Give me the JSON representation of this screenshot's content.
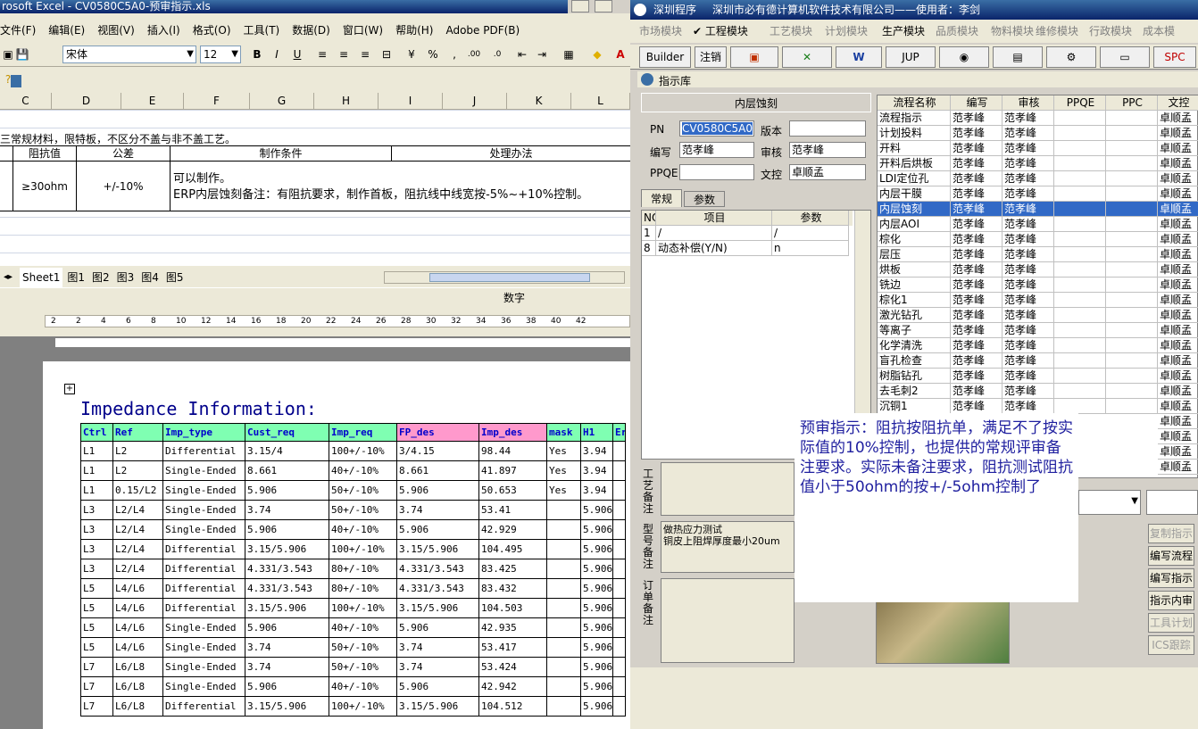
{
  "excel": {
    "title": "rosoft Excel - CV0580C5A0-预审指示.xls",
    "menus": [
      "文件(F)",
      "编辑(E)",
      "视图(V)",
      "插入(I)",
      "格式(O)",
      "工具(T)",
      "数据(D)",
      "窗口(W)",
      "帮助(H)",
      "Adobe PDF(B)"
    ],
    "font_name": "宋体",
    "font_size": "12",
    "columns": [
      "C",
      "D",
      "E",
      "F",
      "G",
      "H",
      "I",
      "J",
      "K",
      "L"
    ],
    "row1_text": "三常规材料，限特板，不区分不盖与非不盖工艺。",
    "headers": [
      "阻抗值",
      "公差",
      "制作条件",
      "处理办法"
    ],
    "row_values": {
      "resistance": "≥30ohm",
      "tolerance": "+/-10%",
      "condition_line1": "可以制作。",
      "condition_line2": "ERP内层蚀刻备注：有阻抗要求，制作首板，阻抗线中线宽按-5%~+10%控制。"
    },
    "sheet_tabs": [
      "Sheet1",
      "图1",
      "图2",
      "图3",
      "图4",
      "图5"
    ],
    "status_text": "数字"
  },
  "word": {
    "ruler_numbers": [
      "2",
      "2",
      "4",
      "6",
      "8",
      "10",
      "12",
      "14",
      "16",
      "18",
      "20",
      "22",
      "24",
      "26",
      "28",
      "30",
      "32",
      "34",
      "36",
      "38",
      "40",
      "42"
    ],
    "title": "Impedance Information:",
    "headers": [
      "Ctrl",
      "Ref",
      "Imp_type",
      "Cust_req",
      "Imp_req",
      "FP_des",
      "Imp_des",
      "mask",
      "H1",
      "Er"
    ],
    "rows": [
      [
        "L1",
        "L2",
        "Differential",
        "3.15/4",
        "100+/-10%",
        "3/4.15",
        "98.44",
        "Yes",
        "3.94",
        ""
      ],
      [
        "L1",
        "L2",
        "Single-Ended",
        "8.661",
        "40+/-10%",
        "8.661",
        "41.897",
        "Yes",
        "3.94",
        ""
      ],
      [
        "L1",
        "0.15/L2",
        "Single-Ended",
        "5.906",
        "50+/-10%",
        "5.906",
        "50.653",
        "Yes",
        "3.94",
        ""
      ],
      [
        "L3",
        "L2/L4",
        "Single-Ended",
        "3.74",
        "50+/-10%",
        "3.74",
        "53.41",
        "",
        "5.906",
        ""
      ],
      [
        "L3",
        "L2/L4",
        "Single-Ended",
        "5.906",
        "40+/-10%",
        "5.906",
        "42.929",
        "",
        "5.906",
        ""
      ],
      [
        "L3",
        "L2/L4",
        "Differential",
        "3.15/5.906",
        "100+/-10%",
        "3.15/5.906",
        "104.495",
        "",
        "5.906",
        ""
      ],
      [
        "L3",
        "L2/L4",
        "Differential",
        "4.331/3.543",
        "80+/-10%",
        "4.331/3.543",
        "83.425",
        "",
        "5.906",
        ""
      ],
      [
        "L5",
        "L4/L6",
        "Differential",
        "4.331/3.543",
        "80+/-10%",
        "4.331/3.543",
        "83.432",
        "",
        "5.906",
        ""
      ],
      [
        "L5",
        "L4/L6",
        "Differential",
        "3.15/5.906",
        "100+/-10%",
        "3.15/5.906",
        "104.503",
        "",
        "5.906",
        ""
      ],
      [
        "L5",
        "L4/L6",
        "Single-Ended",
        "5.906",
        "40+/-10%",
        "5.906",
        "42.935",
        "",
        "5.906",
        ""
      ],
      [
        "L5",
        "L4/L6",
        "Single-Ended",
        "3.74",
        "50+/-10%",
        "3.74",
        "53.417",
        "",
        "5.906",
        ""
      ],
      [
        "L7",
        "L6/L8",
        "Single-Ended",
        "3.74",
        "50+/-10%",
        "3.74",
        "53.424",
        "",
        "5.906",
        ""
      ],
      [
        "L7",
        "L6/L8",
        "Single-Ended",
        "5.906",
        "40+/-10%",
        "5.906",
        "42.942",
        "",
        "5.906",
        ""
      ],
      [
        "L7",
        "L6/L8",
        "Differential",
        "3.15/5.906",
        "100+/-10%",
        "3.15/5.906",
        "104.512",
        "",
        "5.906",
        ""
      ]
    ]
  },
  "erp": {
    "title_app": "深圳程序",
    "title_company": "深圳市必有德计算机软件技术有限公司——使用者：李剑",
    "modules": [
      "市场模块",
      "工程模块",
      "工艺模块",
      "计划模块",
      "生产模块",
      "品质模块",
      "物料模块",
      "维修模块",
      "行政模块",
      "成本模"
    ],
    "tool_builder": "Builder",
    "tool_cancel": "注销",
    "tool_jup": "JUP",
    "tool_spc": "SPC",
    "window_title": "指示库",
    "section": "内层蚀刻",
    "pn_label": "PN",
    "pn_value": "CV0580C5A0",
    "version_label": "版本",
    "version_value": "",
    "author_label": "编写",
    "author_value": "范孝峰",
    "review_label": "审核",
    "review_value": "范孝峰",
    "ppqe_label": "PPQE",
    "ppqe_value": "",
    "doc_label": "文控",
    "doc_value": "卓顺孟",
    "tab_general": "常规",
    "tab_params": "参数",
    "param_headers": [
      "NO",
      "项目",
      "参数"
    ],
    "params": [
      [
        "1",
        "/",
        "/"
      ],
      [
        "8",
        "动态补偿(Y/N)",
        "n"
      ]
    ],
    "process_headers": [
      "流程名称",
      "编写",
      "审核",
      "PPQE",
      "PPC",
      "文控"
    ],
    "processes": [
      [
        "流程指示",
        "范孝峰",
        "范孝峰",
        "",
        "",
        "卓顺孟"
      ],
      [
        "计划投料",
        "范孝峰",
        "范孝峰",
        "",
        "",
        "卓顺孟"
      ],
      [
        "开料",
        "范孝峰",
        "范孝峰",
        "",
        "",
        "卓顺孟"
      ],
      [
        "开料后烘板",
        "范孝峰",
        "范孝峰",
        "",
        "",
        "卓顺孟"
      ],
      [
        "LDI定位孔",
        "范孝峰",
        "范孝峰",
        "",
        "",
        "卓顺孟"
      ],
      [
        "内层干膜",
        "范孝峰",
        "范孝峰",
        "",
        "",
        "卓顺孟"
      ],
      [
        "内层蚀刻",
        "范孝峰",
        "范孝峰",
        "",
        "",
        "卓顺孟"
      ],
      [
        "内层AOI",
        "范孝峰",
        "范孝峰",
        "",
        "",
        "卓顺孟"
      ],
      [
        "棕化",
        "范孝峰",
        "范孝峰",
        "",
        "",
        "卓顺孟"
      ],
      [
        "层压",
        "范孝峰",
        "范孝峰",
        "",
        "",
        "卓顺孟"
      ],
      [
        "烘板",
        "范孝峰",
        "范孝峰",
        "",
        "",
        "卓顺孟"
      ],
      [
        "铣边",
        "范孝峰",
        "范孝峰",
        "",
        "",
        "卓顺孟"
      ],
      [
        "棕化1",
        "范孝峰",
        "范孝峰",
        "",
        "",
        "卓顺孟"
      ],
      [
        "激光钻孔",
        "范孝峰",
        "范孝峰",
        "",
        "",
        "卓顺孟"
      ],
      [
        "等离子",
        "范孝峰",
        "范孝峰",
        "",
        "",
        "卓顺孟"
      ],
      [
        "化学清洗",
        "范孝峰",
        "范孝峰",
        "",
        "",
        "卓顺孟"
      ],
      [
        "盲孔检查",
        "范孝峰",
        "范孝峰",
        "",
        "",
        "卓顺孟"
      ],
      [
        "树脂钻孔",
        "范孝峰",
        "范孝峰",
        "",
        "",
        "卓顺孟"
      ],
      [
        "去毛刺2",
        "范孝峰",
        "范孝峰",
        "",
        "",
        "卓顺孟"
      ],
      [
        "沉铜1",
        "范孝峰",
        "范孝峰",
        "",
        "",
        "卓顺孟"
      ]
    ],
    "extra_doc_rows": [
      "卓顺孟",
      "卓顺孟",
      "卓顺孟",
      "卓顺孟"
    ],
    "note_label_process": "工艺备注",
    "note_label_type": "型号备注",
    "note_label_order": "订单备注",
    "type_note_lines": [
      "做热应力测试",
      "铜皮上阻焊厚度最小20um"
    ],
    "side_buttons": [
      "复制指示",
      "编写流程",
      "编写指示",
      "指示内审",
      "工具计划",
      "ICS跟踪"
    ],
    "overlay_text": "预审指示：阻抗按阻抗单，满足不了按实际值的10%控制，也提供的常规评审备注要求。实际未备注要求，阻抗测试阻抗值小于50ohm的按+/-5ohm控制了"
  },
  "colors": {
    "selected_row": "#3169c6",
    "excel_title": "#0a246a",
    "header_green": "#7fffb2",
    "header_pink": "#ff99cc",
    "overlay_text": "#1f1f9f"
  }
}
